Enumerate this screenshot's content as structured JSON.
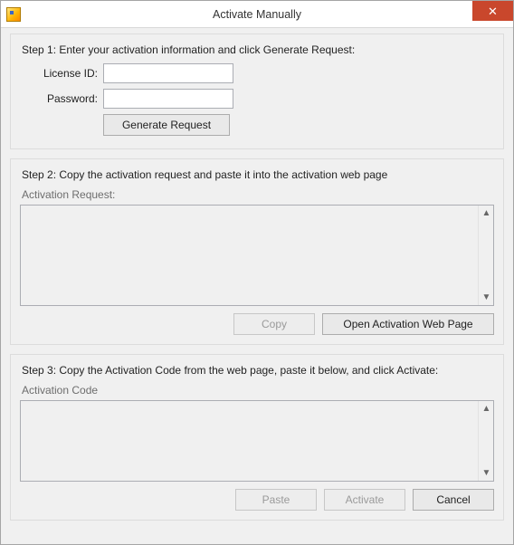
{
  "window": {
    "title": "Activate Manually",
    "close_glyph": "✕"
  },
  "step1": {
    "heading": "Step 1: Enter your activation information and click Generate Request:",
    "license_label": "License ID:",
    "password_label": "Password:",
    "license_value": "",
    "password_value": "",
    "generate_button": "Generate Request"
  },
  "step2": {
    "heading": "Step 2: Copy the activation request and paste it into the activation web page",
    "request_label": "Activation Request:",
    "request_value": "",
    "copy_button": "Copy",
    "open_web_button": "Open Activation Web Page"
  },
  "step3": {
    "heading": "Step 3: Copy the Activation Code from the web page, paste it below, and click Activate:",
    "code_label": "Activation Code",
    "code_value": "",
    "paste_button": "Paste",
    "activate_button": "Activate",
    "cancel_button": "Cancel"
  }
}
